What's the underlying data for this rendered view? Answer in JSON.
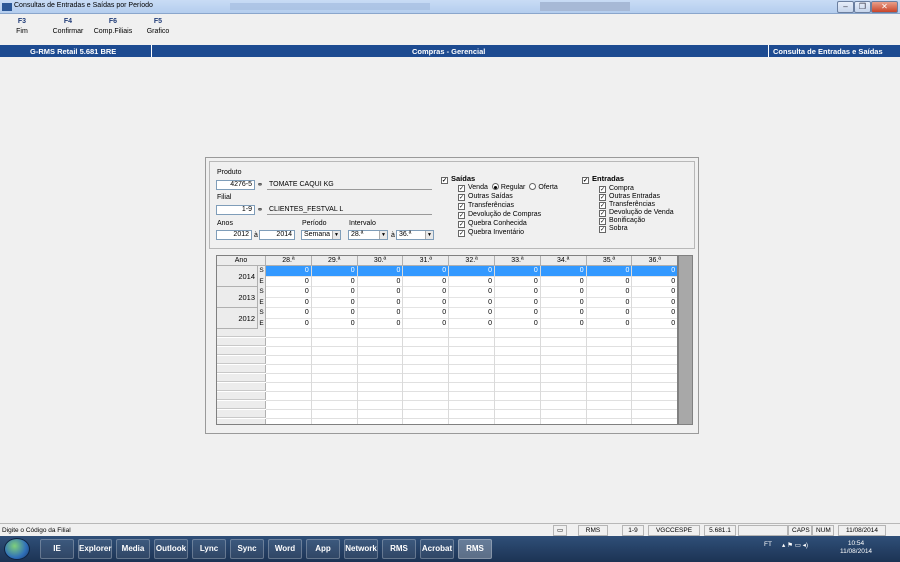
{
  "window": {
    "title": "Consultas de Entradas e Saídas por Período"
  },
  "fkeys": [
    {
      "key": "F3",
      "label": "Fim"
    },
    {
      "key": "F4",
      "label": "Confirmar"
    },
    {
      "key": "F6",
      "label": "Comp.Filiais"
    },
    {
      "key": "F5",
      "label": "Grafico"
    }
  ],
  "band": {
    "left": "G-RMS Retail 5.681 BRE",
    "center": "Compras - Gerencial",
    "right": "Consulta de Entradas e Saídas"
  },
  "filters": {
    "produto_label": "Produto",
    "produto_code": "4276-5",
    "produto_name": "TOMATE CAQUI KG",
    "filial_label": "Filial",
    "filial_code": "1-9",
    "filial_name": "CLIENTES_FESTVAL L",
    "anos_label": "Anos",
    "ano_de": "2012",
    "a1": "à",
    "ano_ate": "2014",
    "periodo_label": "Período",
    "periodo_value": "Semana",
    "intervalo_label": "Intervalo",
    "intervalo_de": "28.ª",
    "a2": "à",
    "intervalo_ate": "36.ª"
  },
  "saidas": {
    "title": "Saídas",
    "venda": "Venda",
    "regular": "Regular",
    "oferta": "Oferta",
    "items": [
      "Outras Saídas",
      "Transferências",
      "Devolução de Compras",
      "Quebra Conhecida",
      "Quebra Inventário"
    ]
  },
  "entradas": {
    "title": "Entradas",
    "items": [
      "Compra",
      "Outras Entradas",
      "Transferências",
      "Devolução de Venda",
      "Bonificação",
      "Sobra"
    ]
  },
  "grid": {
    "ano_header": "Ano",
    "weeks": [
      "28.ª",
      "29.ª",
      "30.ª",
      "31.ª",
      "32.ª",
      "33.ª",
      "34.ª",
      "35.ª",
      "36.ª"
    ],
    "rows": [
      {
        "year": "2014",
        "S": [
          "0",
          "0",
          "0",
          "0",
          "0",
          "0",
          "0",
          "0",
          "0"
        ],
        "E": [
          "0",
          "0",
          "0",
          "0",
          "0",
          "0",
          "0",
          "0",
          "0"
        ]
      },
      {
        "year": "2013",
        "S": [
          "0",
          "0",
          "0",
          "0",
          "0",
          "0",
          "0",
          "0",
          "0"
        ],
        "E": [
          "0",
          "0",
          "0",
          "0",
          "0",
          "0",
          "0",
          "0",
          "0"
        ]
      },
      {
        "year": "2012",
        "S": [
          "0",
          "0",
          "0",
          "0",
          "0",
          "0",
          "0",
          "0",
          "0"
        ],
        "E": [
          "0",
          "0",
          "0",
          "0",
          "0",
          "0",
          "0",
          "0",
          "0"
        ]
      }
    ],
    "s_label": "S",
    "e_label": "E"
  },
  "status": {
    "message": "Digite o Código da Filial",
    "system": "RMS",
    "filial": "1-9",
    "user": "VGCCESPE",
    "version": "5.681.1",
    "caps": "CAPS",
    "num": "NUM",
    "date": "11/08/2014"
  },
  "taskbar": {
    "apps": [
      "IE",
      "Explorer",
      "Media",
      "Outlook",
      "Lync",
      "Sync",
      "Word",
      "App",
      "Network",
      "RMS",
      "Acrobat",
      "RMS"
    ],
    "lang": "FT",
    "time": "10:54",
    "date": "11/08/2014"
  }
}
